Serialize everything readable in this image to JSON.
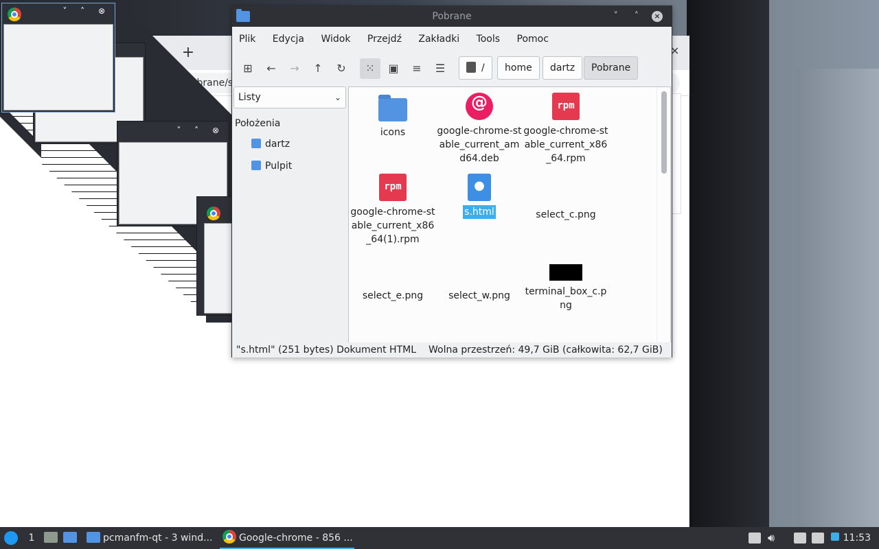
{
  "chrome": {
    "new_tab": "+",
    "close": "×",
    "omnibox_text": "Pobrane/s"
  },
  "cascade": {
    "buttons": "˅ ˄ ⊗"
  },
  "filemanager": {
    "title": "Pobrane",
    "window_buttons": {
      "minimize": "˅",
      "maximize": "˄",
      "close": "×"
    },
    "menu": [
      "Plik",
      "Edycja",
      "Widok",
      "Przejdź",
      "Zakładki",
      "Tools",
      "Pomoc"
    ],
    "breadcrumb": [
      "/",
      "home",
      "dartz",
      "Pobrane"
    ],
    "side_select": "Listy",
    "side_heading": "Położenia",
    "side_items": [
      "dartz",
      "Pulpit"
    ],
    "files": [
      {
        "name": "icons",
        "icon": "folder-icon"
      },
      {
        "name": "google-chrome-stable_current_amd64.deb",
        "icon": "deb-icon"
      },
      {
        "name": "google-chrome-stable_current_x86_64.rpm",
        "icon": "rpm-icon"
      },
      {
        "name": "google-chrome-stable_current_x86_64(1).rpm",
        "icon": "rpm-icon"
      },
      {
        "name": "s.html",
        "icon": "html-icon",
        "selected": true
      },
      {
        "name": "select_c.png",
        "icon": "none"
      },
      {
        "name": "select_e.png",
        "icon": "none"
      },
      {
        "name": "select_w.png",
        "icon": "none"
      },
      {
        "name": "terminal_box_c.png",
        "icon": "black-image-icon"
      }
    ],
    "status_left": "\"s.html\" (251 bytes) Dokument HTML",
    "status_right": "Wolna przestrzeń: 49,7 GiB (całkowita: 62,7 GiB)"
  },
  "taskbar": {
    "desktop_number": "1",
    "tasks": [
      {
        "label": "pcmanfm-qt - 3 wind..."
      },
      {
        "label": "Google-chrome - 856 ..."
      }
    ],
    "clock": "11:53"
  },
  "colors": {
    "accent": "#3daee9",
    "titlebar": "#2e3036",
    "folder": "#5294e2",
    "rpm": "#e53950",
    "deb": "#e91e63"
  }
}
